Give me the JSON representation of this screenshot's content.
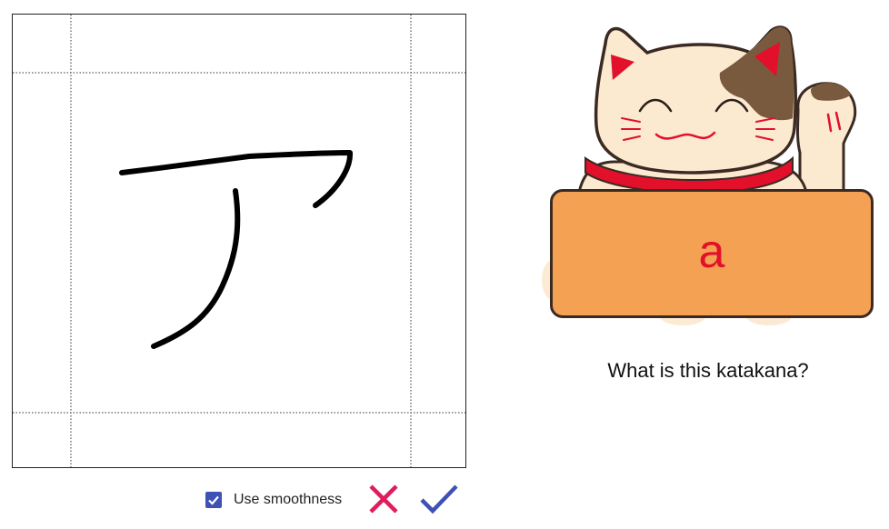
{
  "answer": {
    "romaji": "a"
  },
  "question": {
    "text": "What is this katakana?"
  },
  "controls": {
    "smoothness_label": "Use smoothness",
    "smoothness_checked": true,
    "clear_icon": "close-icon",
    "submit_icon": "check-icon"
  },
  "colors": {
    "accent": "#3f51b5",
    "clear": "#e01c5a",
    "answer_box": "#f5a154",
    "answer_text": "#e2102a",
    "cat_outline": "#3b2a22"
  }
}
